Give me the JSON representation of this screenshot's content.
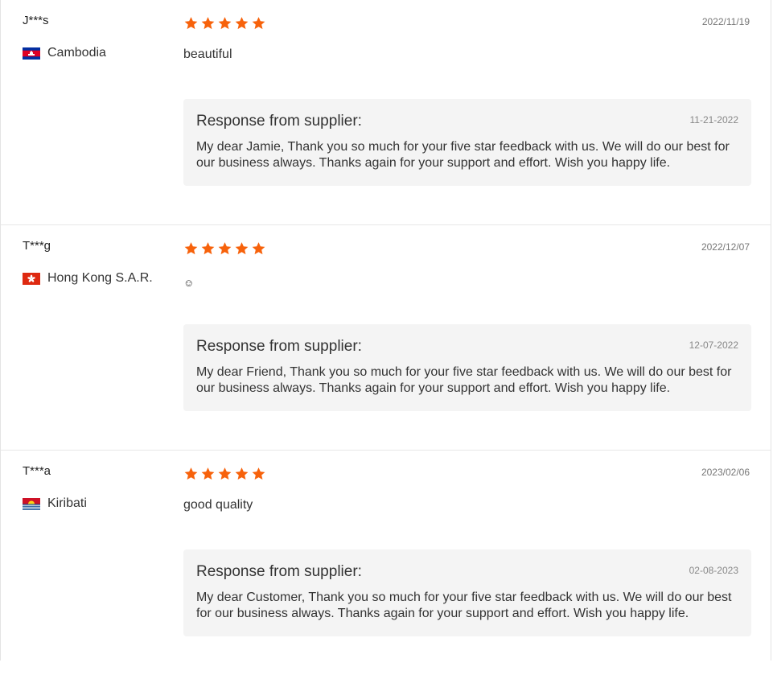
{
  "reviews": [
    {
      "user": "J***s",
      "country": "Cambodia",
      "flag": "cambodia-flag",
      "rating": 5,
      "date": "2022/11/19",
      "comment": "beautiful",
      "response": {
        "title": "Response from supplier:",
        "date": "11-21-2022",
        "text": "My dear Jamie, Thank you so much for your five star feedback with us. We will do our best for our business always. Thanks again for your support and effort. Wish you happy life."
      }
    },
    {
      "user": "T***g",
      "country": "Hong Kong S.A.R.",
      "flag": "hong-kong-flag",
      "rating": 5,
      "date": "2022/12/07",
      "comment": "☺",
      "response": {
        "title": "Response from supplier:",
        "date": "12-07-2022",
        "text": "My dear Friend, Thank you so much for your five star feedback with us. We will do our best for our business always. Thanks again for your support and effort. Wish you happy life."
      }
    },
    {
      "user": "T***a",
      "country": "Kiribati",
      "flag": "kiribati-flag",
      "rating": 5,
      "date": "2023/02/06",
      "comment": "good quality",
      "response": {
        "title": "Response from supplier:",
        "date": "02-08-2023",
        "text": "My dear Customer, Thank you so much for your five star feedback with us. We will do our best for our business always. Thanks again for your support and effort. Wish you happy life."
      }
    }
  ],
  "colors": {
    "star": "#f7620b",
    "response_bg": "#f4f4f4",
    "divider": "#e8e8e8"
  }
}
